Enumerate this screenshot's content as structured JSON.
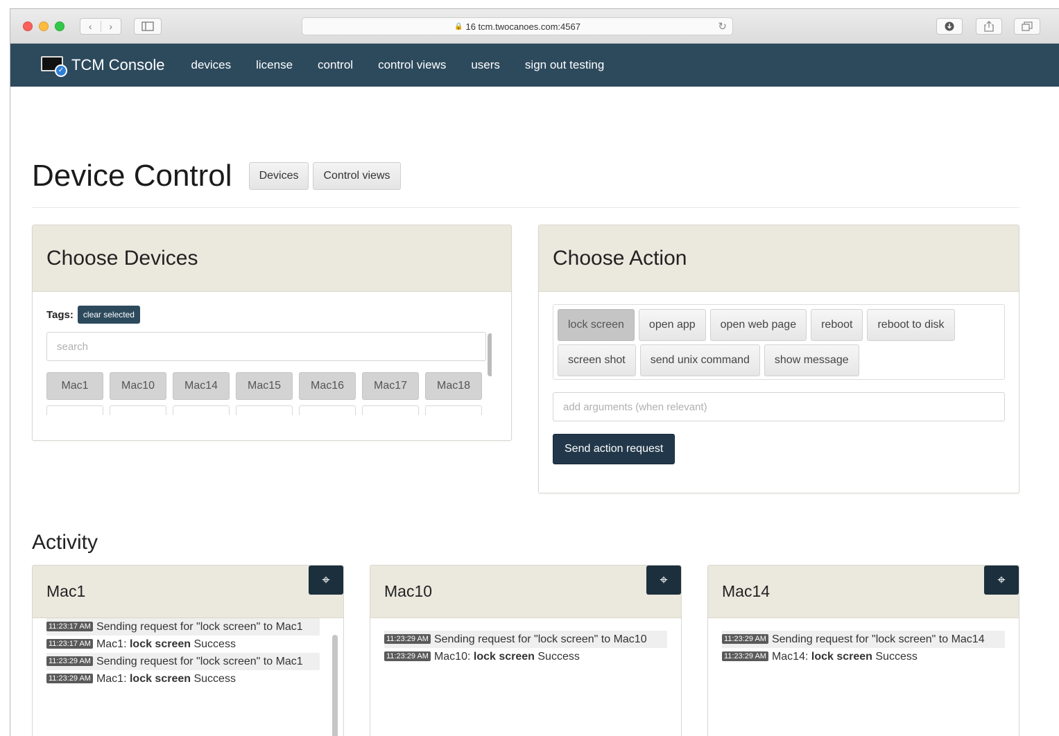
{
  "browser": {
    "url": "16 tcm.twocanoes.com:4567"
  },
  "nav": {
    "brand": "TCM Console",
    "links": [
      "devices",
      "license",
      "control",
      "control views",
      "users",
      "sign out testing"
    ]
  },
  "page": {
    "title": "Device Control",
    "header_buttons": [
      "Devices",
      "Control views"
    ]
  },
  "choose_devices": {
    "title": "Choose Devices",
    "tags_label": "Tags:",
    "clear_selected": "clear selected",
    "search_placeholder": "search",
    "devices": [
      "Mac1",
      "Mac10",
      "Mac14",
      "Mac15",
      "Mac16",
      "Mac17",
      "Mac18"
    ]
  },
  "choose_action": {
    "title": "Choose Action",
    "actions": [
      "lock screen",
      "open app",
      "open web page",
      "reboot",
      "reboot to disk",
      "screen shot",
      "send unix command",
      "show message"
    ],
    "selected_action": "lock screen",
    "args_placeholder": "add arguments (when relevant)",
    "send_button": "Send action request"
  },
  "activity": {
    "title": "Activity",
    "panels": [
      {
        "device": "Mac1",
        "entries": [
          {
            "time": "11:23:17 AM",
            "text": "Sending request for \"lock screen\" to Mac1",
            "shaded": true
          },
          {
            "time": "11:23:17 AM",
            "prefix": "Mac1: ",
            "action": "lock screen",
            "result": " Success",
            "shaded": false
          },
          {
            "time": "11:23:29 AM",
            "text": "Sending request for \"lock screen\" to Mac1",
            "shaded": true
          },
          {
            "time": "11:23:29 AM",
            "prefix": "Mac1: ",
            "action": "lock screen",
            "result": " Success",
            "shaded": false
          }
        ]
      },
      {
        "device": "Mac10",
        "entries": [
          {
            "time": "11:23:29 AM",
            "text": "Sending request for \"lock screen\" to Mac10",
            "shaded": true
          },
          {
            "time": "11:23:29 AM",
            "prefix": "Mac10: ",
            "action": "lock screen",
            "result": " Success",
            "shaded": false
          }
        ]
      },
      {
        "device": "Mac14",
        "entries": [
          {
            "time": "11:23:29 AM",
            "text": "Sending request for \"lock screen\" to Mac14",
            "shaded": true
          },
          {
            "time": "11:23:29 AM",
            "prefix": "Mac14: ",
            "action": "lock screen",
            "result": " Success",
            "shaded": false
          }
        ]
      }
    ]
  },
  "icons": {
    "expand": "expand-icon",
    "lock": "lock-icon",
    "reload": "reload-icon"
  },
  "colors": {
    "navbar": "#2d4a5d",
    "panel_heading": "#ebe8de",
    "primary_button": "#22384a"
  }
}
